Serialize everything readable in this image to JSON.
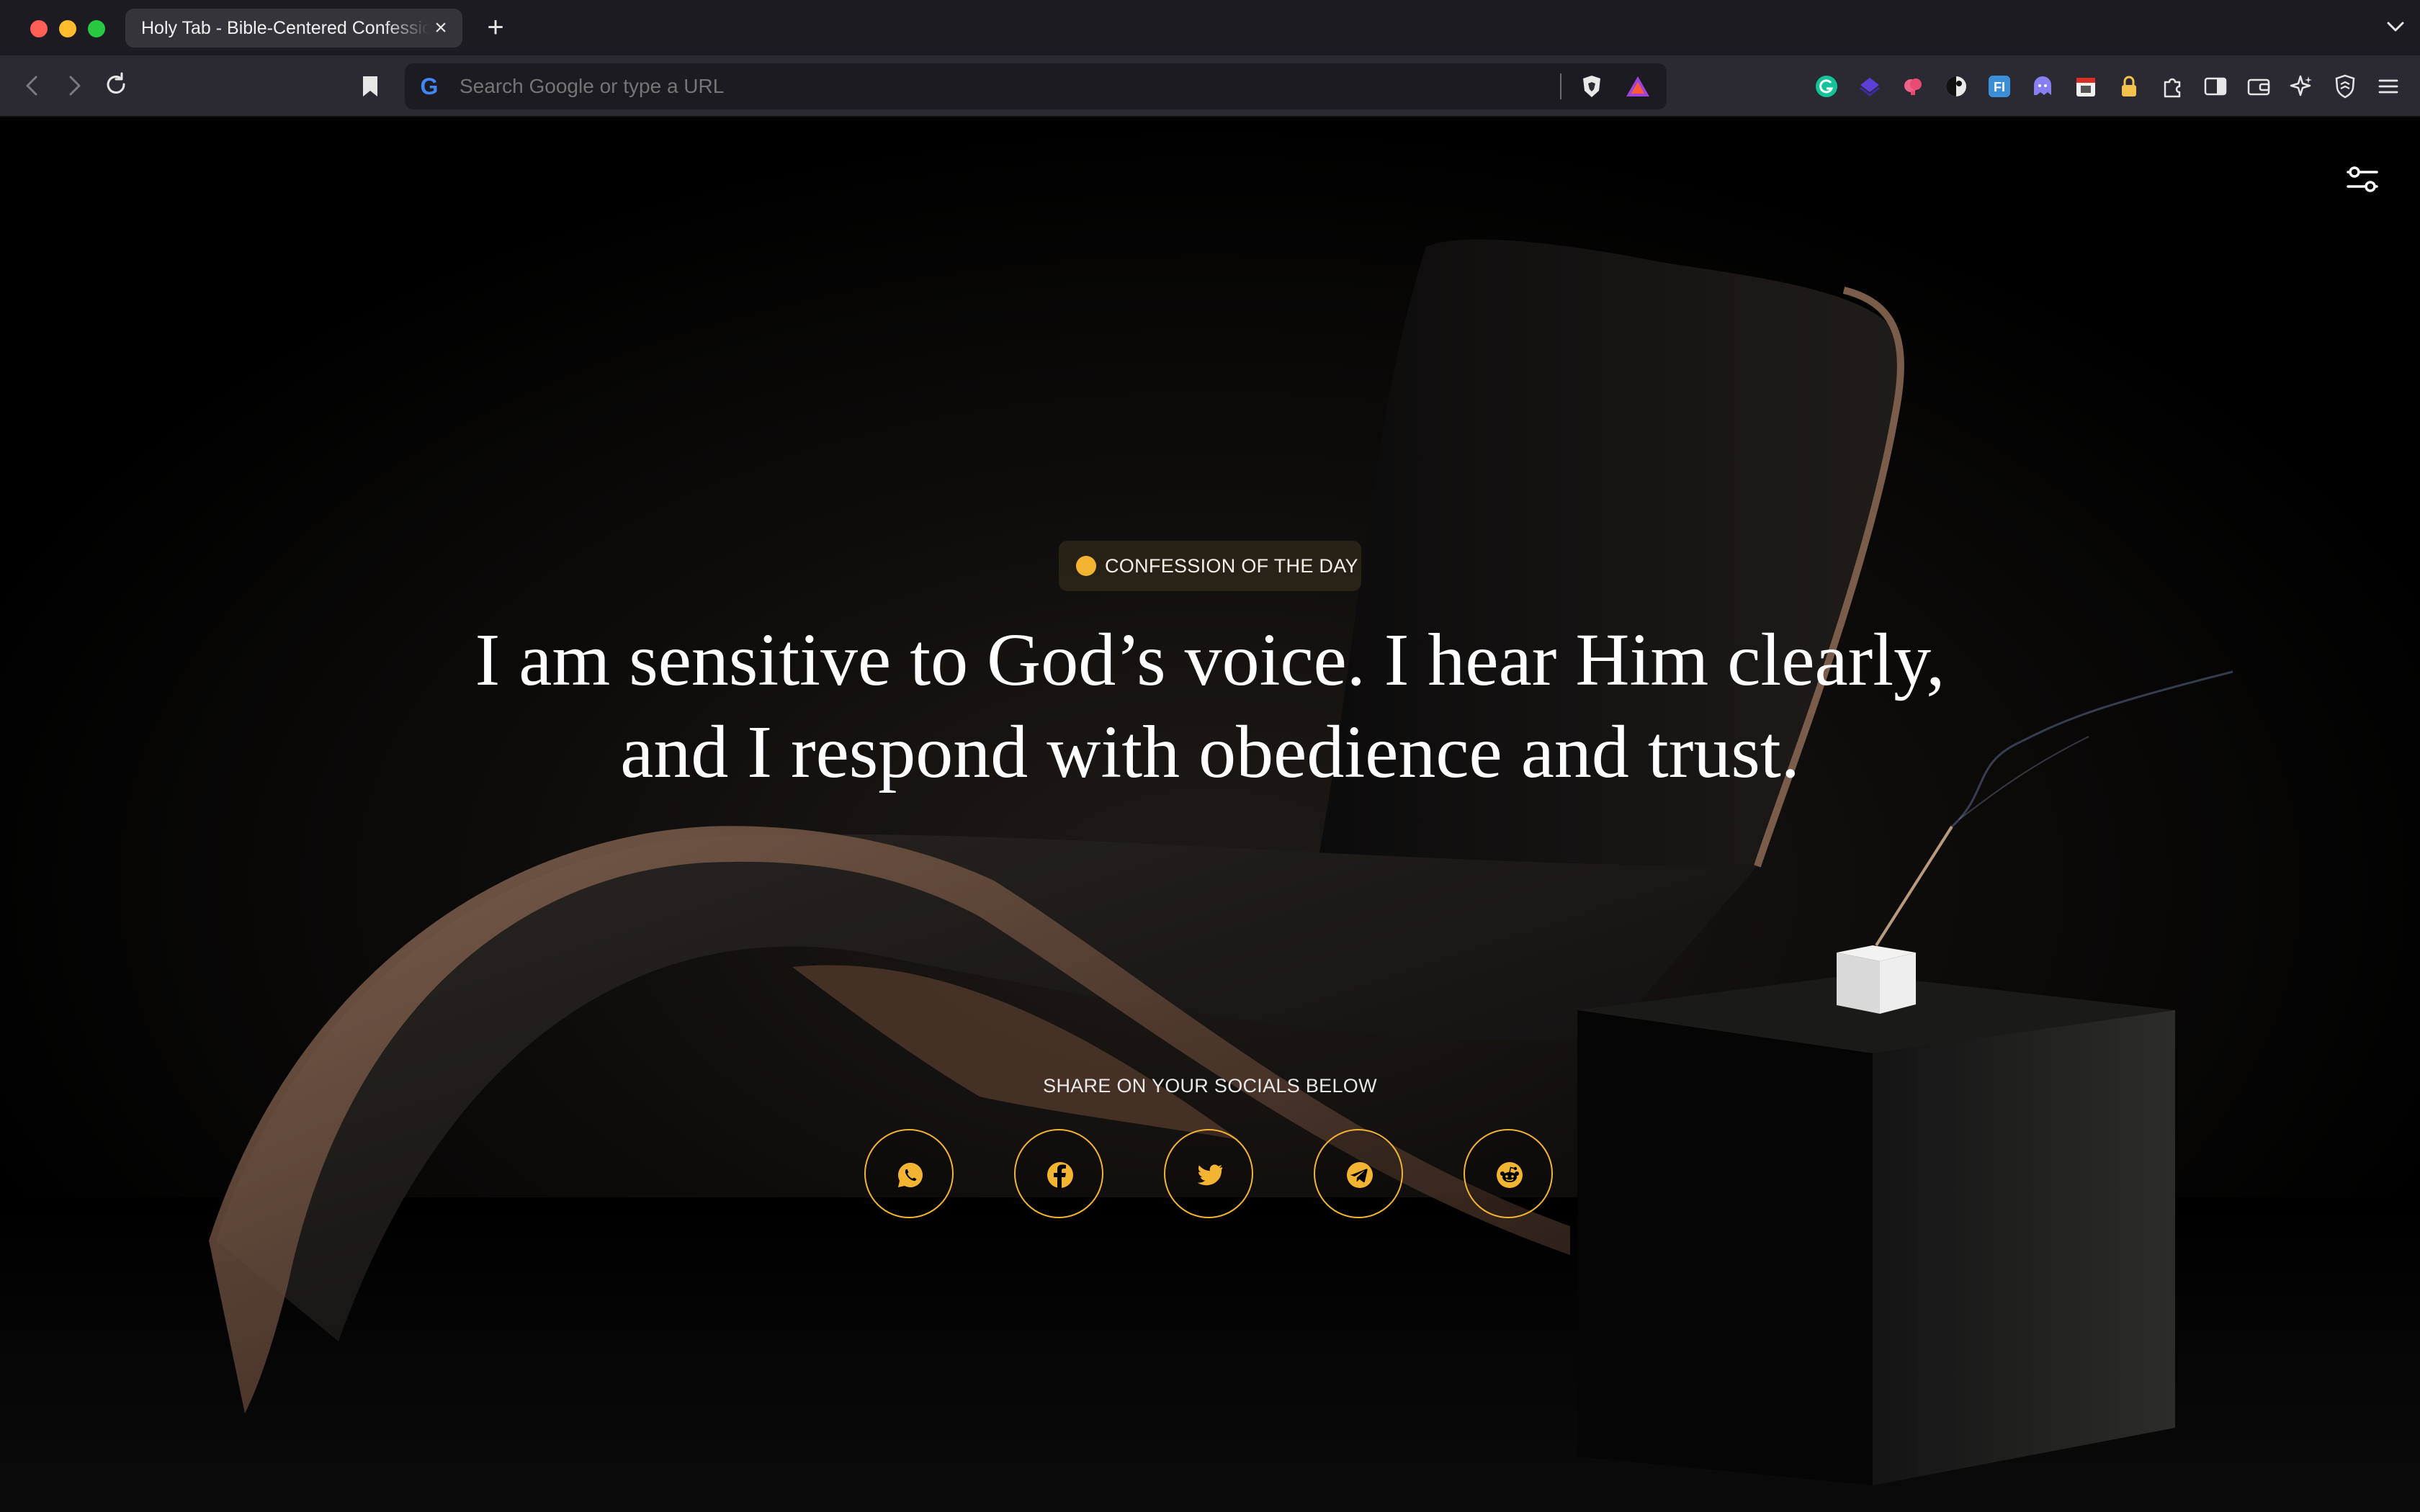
{
  "browser": {
    "tab_title": "Holy Tab - Bible-Centered Confessions",
    "tab_close": "×",
    "new_tab": "+",
    "address_placeholder": "Search Google or type a URL",
    "search_engine_glyph": "G"
  },
  "page": {
    "badge_label": "CONFESSION OF THE DAY",
    "confession_line1": "I am sensitive to God’s voice. I hear Him clearly,",
    "confession_line2": "and I respond with obedience and trust.",
    "share_label": "SHARE ON YOUR SOCIALS BELOW",
    "share_buttons": [
      "whatsapp-icon",
      "facebook-icon",
      "twitter-icon",
      "telegram-icon",
      "reddit-icon"
    ]
  },
  "colors": {
    "accent": "#f3b431",
    "chrome_bg": "#1c1b22",
    "toolbar_bg": "#2b2a33",
    "page_bg": "#000000",
    "text": "#ffffff"
  }
}
